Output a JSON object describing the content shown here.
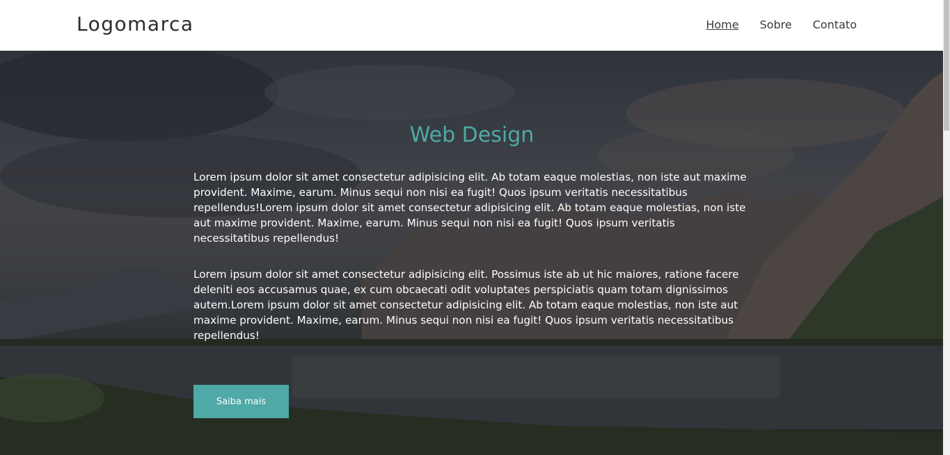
{
  "header": {
    "logo": "Logomarca",
    "nav": [
      {
        "label": "Home",
        "active": true
      },
      {
        "label": "Sobre",
        "active": false
      },
      {
        "label": "Contato",
        "active": false
      }
    ]
  },
  "hero": {
    "title": "Web Design",
    "paragraphs": [
      "Lorem ipsum dolor sit amet consectetur adipisicing elit. Ab totam eaque molestias, non iste aut maxime provident. Maxime, earum. Minus sequi non nisi ea fugit! Quos ipsum veritatis necessitatibus repellendus!Lorem ipsum dolor sit amet consectetur adipisicing elit. Ab totam eaque molestias, non iste aut maxime provident. Maxime, earum. Minus sequi non nisi ea fugit! Quos ipsum veritatis necessitatibus repellendus!",
      "Lorem ipsum dolor sit amet consectetur adipisicing elit. Possimus iste ab ut hic maiores, ratione facere deleniti eos accusamus quae, ex cum obcaecati odit voluptates perspiciatis quam totam dignissimos autem.Lorem ipsum dolor sit amet consectetur adipisicing elit. Ab totam eaque molestias, non iste aut maxime provident. Maxime, earum. Minus sequi non nisi ea fugit! Quos ipsum veritatis necessitatibus repellendus!"
    ],
    "button_label": "Saiba mais",
    "background_icon": "mountain-lake-landscape"
  },
  "colors": {
    "accent": "#4fa9a6",
    "header_bg": "#ffffff",
    "text_light": "#ffffff",
    "text_dark": "#2b2b2b"
  }
}
